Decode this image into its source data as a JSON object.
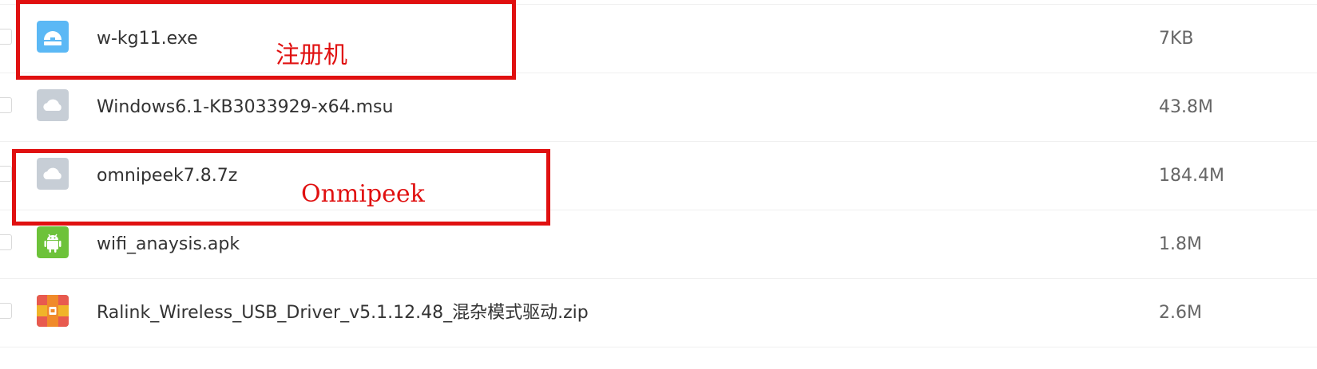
{
  "files": [
    {
      "name": "w-kg11.exe",
      "size": "7KB",
      "icon": "exe-file-icon",
      "icon_color": "#5bb8f5"
    },
    {
      "name": "Windows6.1-KB3033929-x64.msu",
      "size": "43.8M",
      "icon": "cloud-file-icon",
      "icon_color": "#c7ced6"
    },
    {
      "name": "omnipeek7.8.7z",
      "size": "184.4M",
      "icon": "cloud-file-icon",
      "icon_color": "#c7ced6"
    },
    {
      "name": "wifi_anaysis.apk",
      "size": "1.8M",
      "icon": "android-apk-icon",
      "icon_color": "#6dc23a"
    },
    {
      "name": "Ralink_Wireless_USB_Driver_v5.1.12.48_混杂模式驱动.zip",
      "size": "2.6M",
      "icon": "zip-archive-icon",
      "icon_color": "#f08a2a"
    }
  ],
  "annotations": [
    {
      "label": "注册机",
      "color": "#e01010"
    },
    {
      "label": "Onmipeek",
      "color": "#e01010"
    }
  ]
}
